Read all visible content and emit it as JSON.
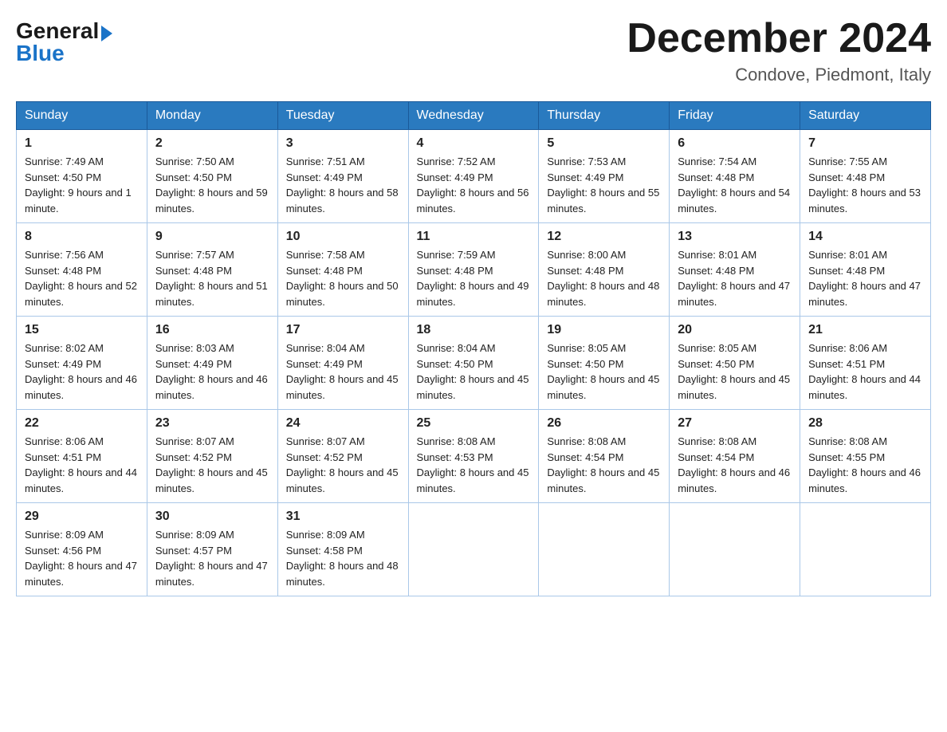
{
  "logo": {
    "text_general": "General",
    "text_blue": "Blue"
  },
  "title": "December 2024",
  "location": "Condove, Piedmont, Italy",
  "weekdays": [
    "Sunday",
    "Monday",
    "Tuesday",
    "Wednesday",
    "Thursday",
    "Friday",
    "Saturday"
  ],
  "weeks": [
    [
      {
        "day": "1",
        "sunrise": "7:49 AM",
        "sunset": "4:50 PM",
        "daylight": "9 hours and 1 minute."
      },
      {
        "day": "2",
        "sunrise": "7:50 AM",
        "sunset": "4:50 PM",
        "daylight": "8 hours and 59 minutes."
      },
      {
        "day": "3",
        "sunrise": "7:51 AM",
        "sunset": "4:49 PM",
        "daylight": "8 hours and 58 minutes."
      },
      {
        "day": "4",
        "sunrise": "7:52 AM",
        "sunset": "4:49 PM",
        "daylight": "8 hours and 56 minutes."
      },
      {
        "day": "5",
        "sunrise": "7:53 AM",
        "sunset": "4:49 PM",
        "daylight": "8 hours and 55 minutes."
      },
      {
        "day": "6",
        "sunrise": "7:54 AM",
        "sunset": "4:48 PM",
        "daylight": "8 hours and 54 minutes."
      },
      {
        "day": "7",
        "sunrise": "7:55 AM",
        "sunset": "4:48 PM",
        "daylight": "8 hours and 53 minutes."
      }
    ],
    [
      {
        "day": "8",
        "sunrise": "7:56 AM",
        "sunset": "4:48 PM",
        "daylight": "8 hours and 52 minutes."
      },
      {
        "day": "9",
        "sunrise": "7:57 AM",
        "sunset": "4:48 PM",
        "daylight": "8 hours and 51 minutes."
      },
      {
        "day": "10",
        "sunrise": "7:58 AM",
        "sunset": "4:48 PM",
        "daylight": "8 hours and 50 minutes."
      },
      {
        "day": "11",
        "sunrise": "7:59 AM",
        "sunset": "4:48 PM",
        "daylight": "8 hours and 49 minutes."
      },
      {
        "day": "12",
        "sunrise": "8:00 AM",
        "sunset": "4:48 PM",
        "daylight": "8 hours and 48 minutes."
      },
      {
        "day": "13",
        "sunrise": "8:01 AM",
        "sunset": "4:48 PM",
        "daylight": "8 hours and 47 minutes."
      },
      {
        "day": "14",
        "sunrise": "8:01 AM",
        "sunset": "4:48 PM",
        "daylight": "8 hours and 47 minutes."
      }
    ],
    [
      {
        "day": "15",
        "sunrise": "8:02 AM",
        "sunset": "4:49 PM",
        "daylight": "8 hours and 46 minutes."
      },
      {
        "day": "16",
        "sunrise": "8:03 AM",
        "sunset": "4:49 PM",
        "daylight": "8 hours and 46 minutes."
      },
      {
        "day": "17",
        "sunrise": "8:04 AM",
        "sunset": "4:49 PM",
        "daylight": "8 hours and 45 minutes."
      },
      {
        "day": "18",
        "sunrise": "8:04 AM",
        "sunset": "4:50 PM",
        "daylight": "8 hours and 45 minutes."
      },
      {
        "day": "19",
        "sunrise": "8:05 AM",
        "sunset": "4:50 PM",
        "daylight": "8 hours and 45 minutes."
      },
      {
        "day": "20",
        "sunrise": "8:05 AM",
        "sunset": "4:50 PM",
        "daylight": "8 hours and 45 minutes."
      },
      {
        "day": "21",
        "sunrise": "8:06 AM",
        "sunset": "4:51 PM",
        "daylight": "8 hours and 44 minutes."
      }
    ],
    [
      {
        "day": "22",
        "sunrise": "8:06 AM",
        "sunset": "4:51 PM",
        "daylight": "8 hours and 44 minutes."
      },
      {
        "day": "23",
        "sunrise": "8:07 AM",
        "sunset": "4:52 PM",
        "daylight": "8 hours and 45 minutes."
      },
      {
        "day": "24",
        "sunrise": "8:07 AM",
        "sunset": "4:52 PM",
        "daylight": "8 hours and 45 minutes."
      },
      {
        "day": "25",
        "sunrise": "8:08 AM",
        "sunset": "4:53 PM",
        "daylight": "8 hours and 45 minutes."
      },
      {
        "day": "26",
        "sunrise": "8:08 AM",
        "sunset": "4:54 PM",
        "daylight": "8 hours and 45 minutes."
      },
      {
        "day": "27",
        "sunrise": "8:08 AM",
        "sunset": "4:54 PM",
        "daylight": "8 hours and 46 minutes."
      },
      {
        "day": "28",
        "sunrise": "8:08 AM",
        "sunset": "4:55 PM",
        "daylight": "8 hours and 46 minutes."
      }
    ],
    [
      {
        "day": "29",
        "sunrise": "8:09 AM",
        "sunset": "4:56 PM",
        "daylight": "8 hours and 47 minutes."
      },
      {
        "day": "30",
        "sunrise": "8:09 AM",
        "sunset": "4:57 PM",
        "daylight": "8 hours and 47 minutes."
      },
      {
        "day": "31",
        "sunrise": "8:09 AM",
        "sunset": "4:58 PM",
        "daylight": "8 hours and 48 minutes."
      },
      null,
      null,
      null,
      null
    ]
  ]
}
